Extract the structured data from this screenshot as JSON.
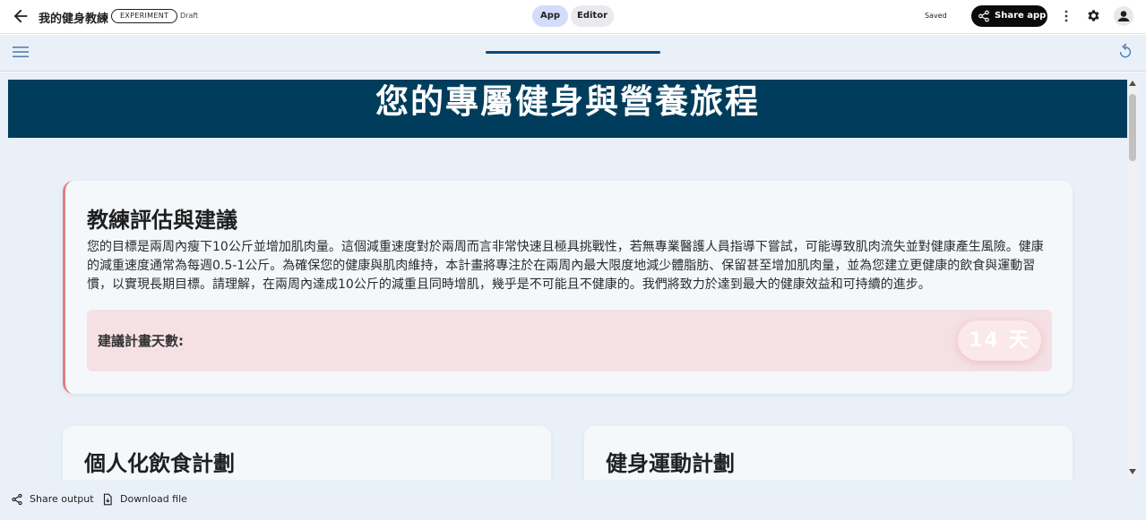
{
  "header": {
    "app_title": "我的健身教練",
    "experiment_badge": "EXPERIMENT",
    "draft_label": "Draft",
    "tabs": {
      "app": "App",
      "editor": "Editor"
    },
    "active_tab": "App",
    "saved_label": "Saved",
    "share_app_label": "Share app",
    "icons": [
      "back-arrow-icon",
      "share-icon",
      "more-vert-icon",
      "gear-icon",
      "account-icon"
    ]
  },
  "appbar": {
    "progress": 1.0,
    "icons": [
      "menu-icon",
      "reload-icon"
    ]
  },
  "hero": {
    "title": "您的專屬健身與營養旅程"
  },
  "coach": {
    "heading": "教練評估與建議",
    "body": "您的目標是兩周內瘦下10公斤並增加肌肉量。這個減重速度對於兩周而言非常快速且極具挑戰性，若無專業醫護人員指導下嘗試，可能導致肌肉流失並對健康產生風險。健康的減重速度通常為每週0.5-1公斤。為確保您的健康與肌肉維持，本計畫將專注於在兩周內最大限度地減少體脂肪、保留甚至增加肌肉量，並為您建立更健康的飲食與運動習慣，以實現長期目標。請理解，在兩周內達成10公斤的減重且同時增肌，幾乎是不可能且不健康的。我們將致力於達到最大的健康效益和可持續的進步。",
    "days_label": "建議計畫天數:",
    "days_value": "14 天"
  },
  "sections": {
    "diet_heading": "個人化飲食計劃",
    "workout_heading": "健身運動計劃"
  },
  "footer": {
    "share_output": "Share output",
    "download_file": "Download file"
  },
  "colors": {
    "hero_bg": "#003d5c",
    "accent_border": "#e57c84",
    "days_box_bg": "#f5e1e5",
    "active_tab_bg": "#d3dcfa",
    "share_button_bg": "#0b0b0b"
  }
}
